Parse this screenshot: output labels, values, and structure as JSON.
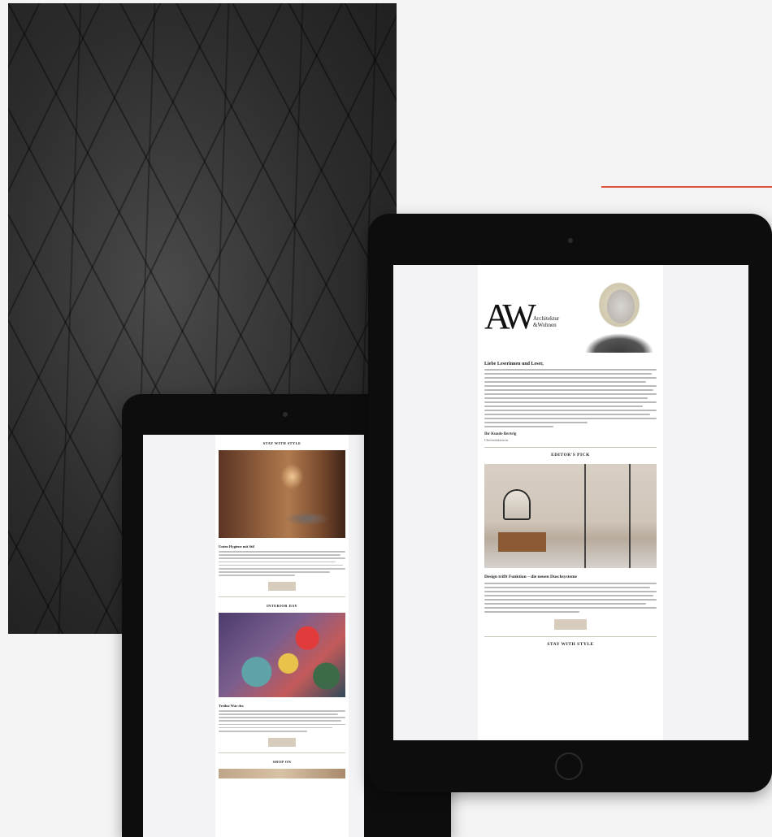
{
  "colors": {
    "accent_line": "#e0523d",
    "button": "#d8ccbd"
  },
  "big_email": {
    "logo": "AW",
    "logo_subtitle_1": "Architektur",
    "logo_subtitle_2": "&Wohnen",
    "greeting": "Liebe Leserinnen und Leser,",
    "signature_name": "Ihr Kunde Bertrig",
    "signature_role": "Chefredakteurin",
    "section_1": "EDITOR'S PICK",
    "card_1_title": "Design trifft Funktion – die neuen Duschsysteme",
    "section_2": "STAY WITH STYLE"
  },
  "small_email": {
    "section_1": "STAY WITH STYLE",
    "card_1_title": "Unten Hygiene mit Stil",
    "section_2": "INTERIOR DAY",
    "card_2_title": "Treibst Wär des",
    "section_3": "SHOP ON"
  }
}
